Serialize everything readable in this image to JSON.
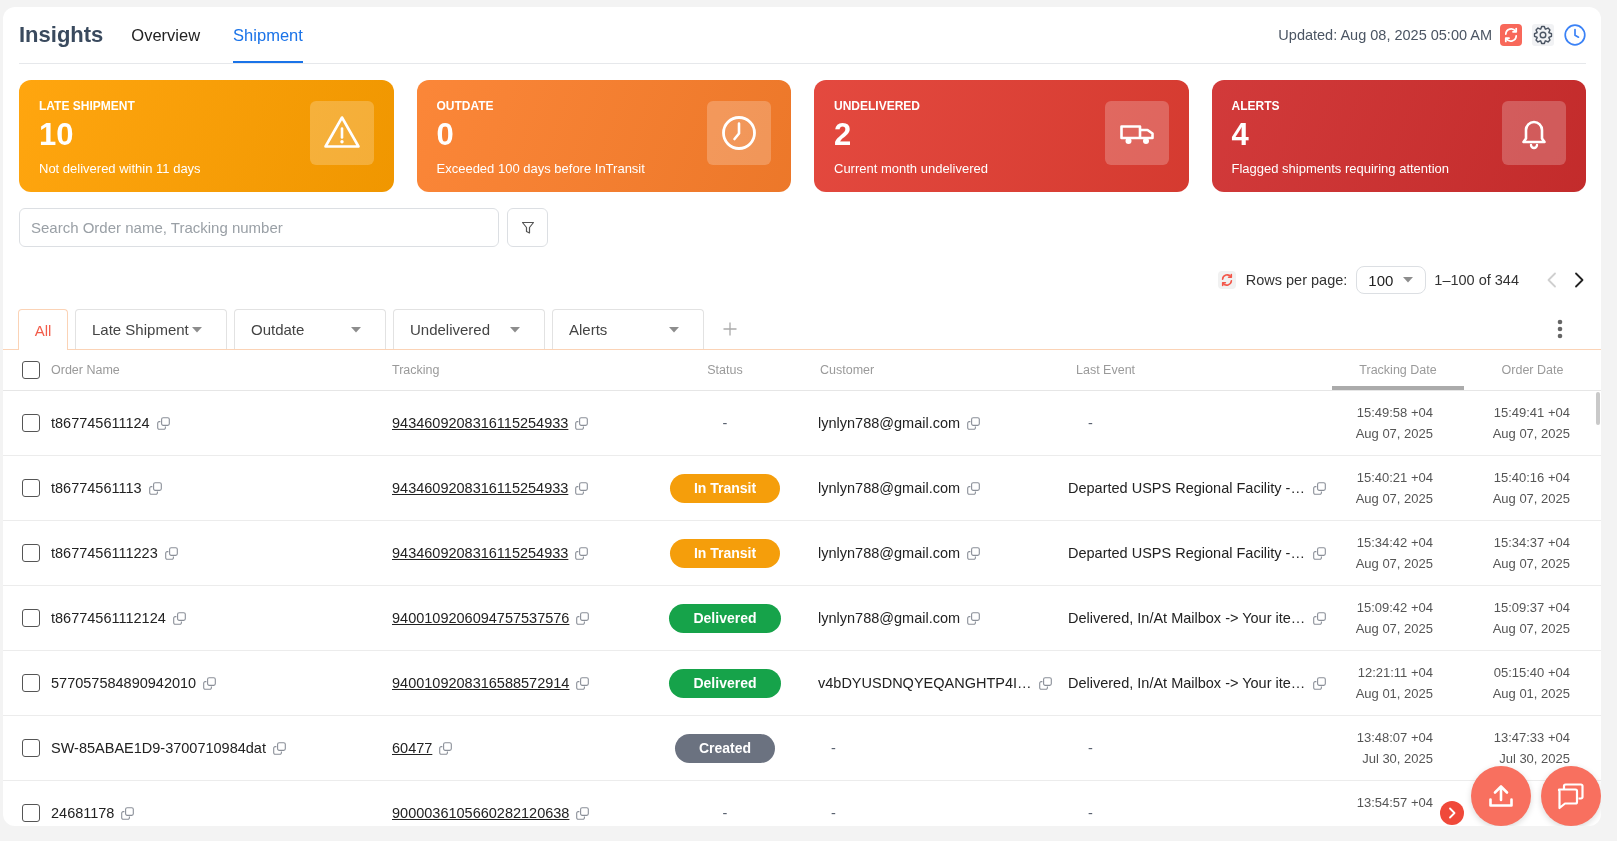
{
  "header": {
    "title": "Insights",
    "tabs": [
      {
        "label": "Overview",
        "selected": false
      },
      {
        "label": "Shipment",
        "selected": true
      }
    ],
    "updated": "Updated: Aug 08, 2025 05:00 AM"
  },
  "summary_cards": [
    {
      "kind": "late",
      "label": "LATE SHIPMENT",
      "value": "10",
      "description": "Not delivered within 11 days",
      "color": "#ffa000"
    },
    {
      "kind": "outdate",
      "label": "OUTDATE",
      "value": "0",
      "description": "Exceeded 100 days before InTransit",
      "color": "#fb7f2c"
    },
    {
      "kind": "undelivered",
      "label": "UNDELIVERED",
      "value": "2",
      "description": "Current month undelivered",
      "color": "#e23e33"
    },
    {
      "kind": "alerts",
      "label": "ALERTS",
      "value": "4",
      "description": "Flagged shipments requiring attention",
      "color": "#cf2e2e"
    }
  ],
  "search": {
    "placeholder": "Search Order name, Tracking number"
  },
  "pagination": {
    "label": "Rows per page:",
    "rows_per_page": "100",
    "range": "1–100 of 344",
    "previous_disabled": true,
    "next_disabled": false
  },
  "filter_tabs": [
    {
      "kind": "plain",
      "label": "All",
      "selected": true
    },
    {
      "kind": "dropdown",
      "label": "Late Shipment",
      "selected": false
    },
    {
      "kind": "dropdown",
      "label": "Outdate",
      "selected": false
    },
    {
      "kind": "dropdown",
      "label": "Undelivered",
      "selected": false
    },
    {
      "kind": "dropdown",
      "label": "Alerts",
      "selected": false
    }
  ],
  "table": {
    "select_all": {
      "checked": false
    },
    "columns": [
      {
        "label": "Order Name",
        "highlighted": false
      },
      {
        "label": "Tracking",
        "highlighted": false
      },
      {
        "label": "Status",
        "highlighted": false
      },
      {
        "label": "Customer",
        "highlighted": false
      },
      {
        "label": "Last Event",
        "highlighted": false
      },
      {
        "label": "Tracking Date",
        "highlighted": true
      },
      {
        "label": "Order Date",
        "highlighted": false
      }
    ],
    "rows": [
      {
        "checked": false,
        "order_name": "t867745611124",
        "tracking": "9434609208316115254933",
        "status": {
          "kind": "text",
          "label": "-"
        },
        "customer": {
          "text": "lynlyn788@gmail.com",
          "copyable": true
        },
        "last_event": {
          "text": "-",
          "copyable": false
        },
        "tracking_date": [
          "15:49:58 +04",
          "Aug 07, 2025"
        ],
        "order_date": [
          "15:49:41 +04",
          "Aug 07, 2025"
        ]
      },
      {
        "checked": false,
        "order_name": "t86774561113",
        "tracking": "9434609208316115254933",
        "status": {
          "kind": "badge",
          "label": "In Transit",
          "color": "#f59e0b"
        },
        "customer": {
          "text": "lynlyn788@gmail.com",
          "copyable": true
        },
        "last_event": {
          "text": "Departed USPS Regional Facility -…",
          "copyable": true
        },
        "tracking_date": [
          "15:40:21 +04",
          "Aug 07, 2025"
        ],
        "order_date": [
          "15:40:16 +04",
          "Aug 07, 2025"
        ]
      },
      {
        "checked": false,
        "order_name": "t8677456111223",
        "tracking": "9434609208316115254933",
        "status": {
          "kind": "badge",
          "label": "In Transit",
          "color": "#f59e0b"
        },
        "customer": {
          "text": "lynlyn788@gmail.com",
          "copyable": true
        },
        "last_event": {
          "text": "Departed USPS Regional Facility -…",
          "copyable": true
        },
        "tracking_date": [
          "15:34:42 +04",
          "Aug 07, 2025"
        ],
        "order_date": [
          "15:34:37 +04",
          "Aug 07, 2025"
        ]
      },
      {
        "checked": false,
        "order_name": "t86774561112124",
        "tracking": "9400109206094757537576",
        "status": {
          "kind": "badge",
          "label": "Delivered",
          "color": "#16a34a"
        },
        "customer": {
          "text": "lynlyn788@gmail.com",
          "copyable": true
        },
        "last_event": {
          "text": "Delivered, In/At Mailbox -> Your ite…",
          "copyable": true
        },
        "tracking_date": [
          "15:09:42 +04",
          "Aug 07, 2025"
        ],
        "order_date": [
          "15:09:37 +04",
          "Aug 07, 2025"
        ]
      },
      {
        "checked": false,
        "order_name": "577057584890942010",
        "tracking": "9400109208316588572914",
        "status": {
          "kind": "badge",
          "label": "Delivered",
          "color": "#16a34a"
        },
        "customer": {
          "text": "v4bDYUSDNQYEQANGHTP4I…",
          "copyable": true
        },
        "last_event": {
          "text": "Delivered, In/At Mailbox -> Your ite…",
          "copyable": true
        },
        "tracking_date": [
          "12:21:11 +04",
          "Aug 01, 2025"
        ],
        "order_date": [
          "05:15:40 +04",
          "Aug 01, 2025"
        ]
      },
      {
        "checked": false,
        "order_name": "SW-85ABAE1D9-3700710984dat",
        "tracking": "60477",
        "status": {
          "kind": "badge",
          "label": "Created",
          "color": "#6b7280"
        },
        "customer": {
          "text": "-",
          "copyable": false
        },
        "last_event": {
          "text": "-",
          "copyable": false
        },
        "tracking_date": [
          "13:48:07 +04",
          "Jul 30, 2025"
        ],
        "order_date": [
          "13:47:33 +04",
          "Jul 30, 2025"
        ]
      },
      {
        "checked": false,
        "order_name": "24681178",
        "tracking": "9000036105660282120638",
        "status": {
          "kind": "text",
          "label": "-"
        },
        "customer": {
          "text": "-",
          "copyable": false
        },
        "last_event": {
          "text": "-",
          "copyable": false
        },
        "tracking_date": [
          "13:54:57 +04"
        ]
      }
    ]
  }
}
